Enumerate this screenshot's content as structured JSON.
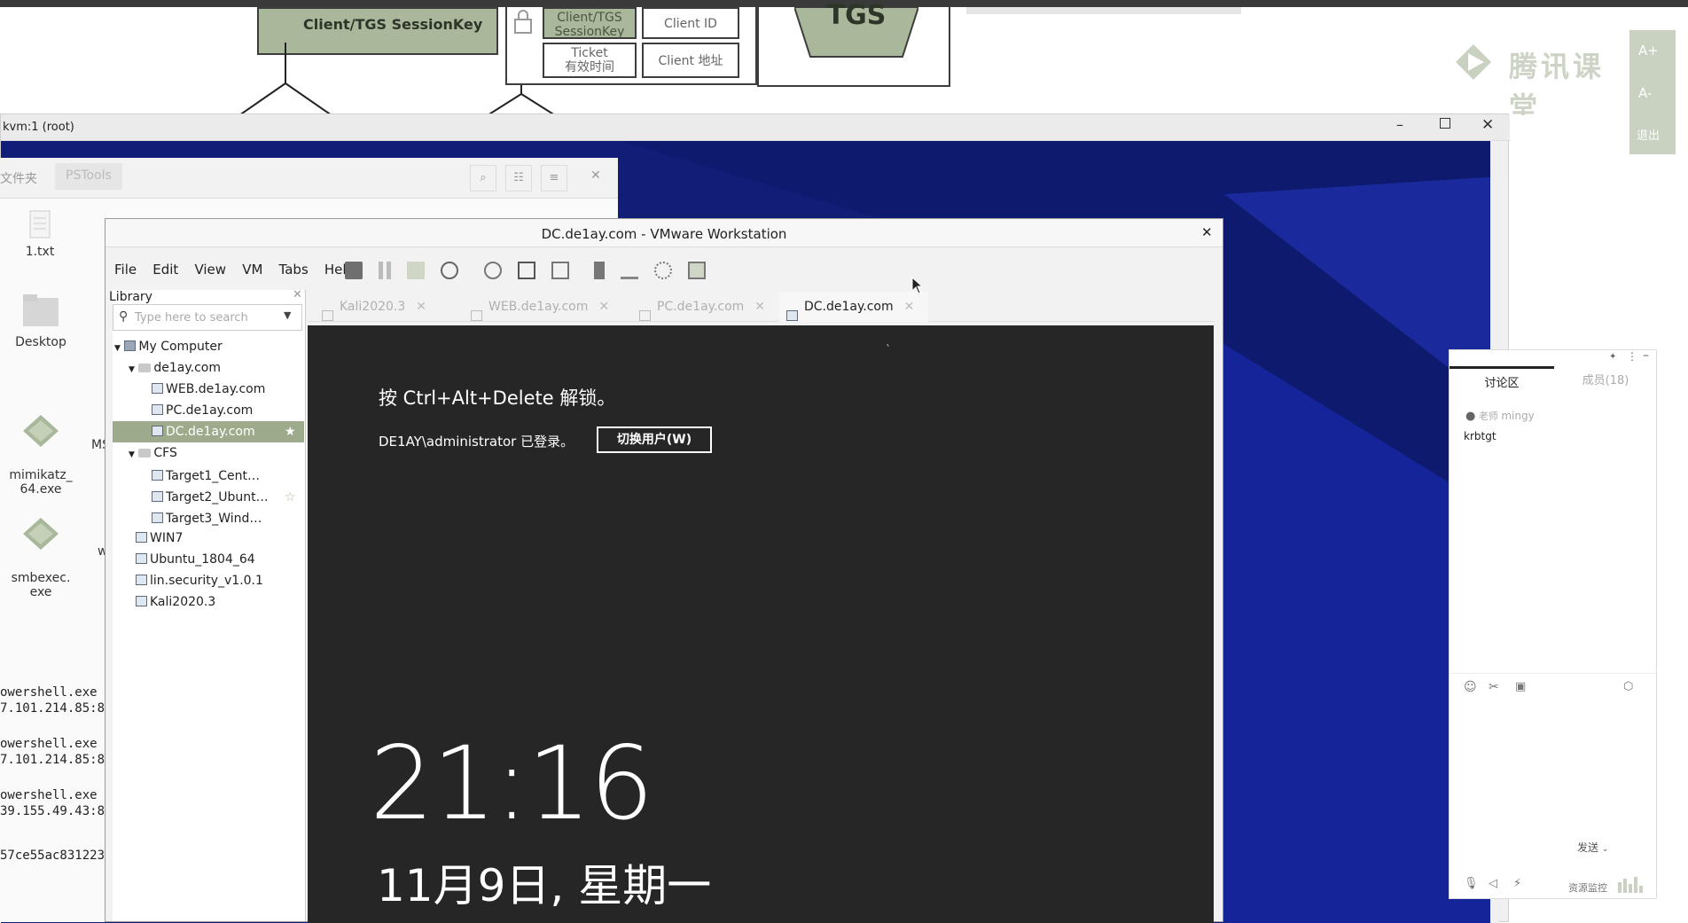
{
  "slide": {
    "session_key_label": "Client/TGS SessionKey",
    "cell_session_key": "Client/TGS SessionKey",
    "cell_client_id": "Client ID",
    "cell_ticket": "Ticket",
    "cell_ticket_validity": "有效时间",
    "cell_client_addr": "Client 地址",
    "tgs_label": "TGS",
    "watermark": "腾讯课堂",
    "font_plus": "A+",
    "font_minus": "A-",
    "exit": "退出"
  },
  "kvm": {
    "title": "kvm:1 (root)"
  },
  "file_manager": {
    "breadcrumb_folder": "文件夹",
    "breadcrumb_current": "PSTools",
    "icons": [
      {
        "label": "1.txt"
      },
      {
        "label": "Desktop"
      },
      {
        "label": "mimikatz_\n64.exe"
      },
      {
        "label": "smbexec.\nexe"
      }
    ],
    "partial_labels": [
      "MS",
      "w"
    ],
    "terminal_lines": [
      "owershell.exe",
      "7.101.214.85:8",
      "owershell.exe",
      "7.101.214.85:8",
      "owershell.exe",
      "39.155.49.43:8",
      "57ce55ac831223"
    ]
  },
  "vmware": {
    "title": "DC.de1ay.com - VMware Workstation",
    "menu": [
      "File",
      "Edit",
      "View",
      "VM",
      "Tabs",
      "Help"
    ],
    "library_title": "Library",
    "search_placeholder": "Type here to search",
    "tree": [
      {
        "label": "My Computer"
      },
      {
        "label": "de1ay.com"
      },
      {
        "label": "WEB.de1ay.com"
      },
      {
        "label": "PC.de1ay.com"
      },
      {
        "label": "DC.de1ay.com"
      },
      {
        "label": "CFS"
      },
      {
        "label": "Target1_Cent…"
      },
      {
        "label": "Target2_Ubunt…"
      },
      {
        "label": "Target3_Wind…"
      },
      {
        "label": "WIN7"
      },
      {
        "label": "Ubuntu_1804_64"
      },
      {
        "label": "lin.security_v1.0.1"
      },
      {
        "label": "Kali2020.3"
      }
    ],
    "tabs": [
      {
        "label": "Kali2020.3",
        "active": false
      },
      {
        "label": "WEB.de1ay.com",
        "active": false
      },
      {
        "label": "PC.de1ay.com",
        "active": false
      },
      {
        "label": "DC.de1ay.com",
        "active": true
      }
    ],
    "guest": {
      "unlock_hint": "按 Ctrl+Alt+Delete 解锁。",
      "logged_in": "DE1AY\\administrator 已登录。",
      "switch_user": "切换用户(W)",
      "time": "21:16",
      "date": "11月9日, 星期一"
    }
  },
  "chat": {
    "tab_discussion": "讨论区",
    "tab_members": "成员(18)",
    "messages": [
      {
        "role": "老师",
        "user": "mingy",
        "text": "krbtgt"
      }
    ],
    "send": "发送",
    "resource_monitor": "资源监控"
  }
}
